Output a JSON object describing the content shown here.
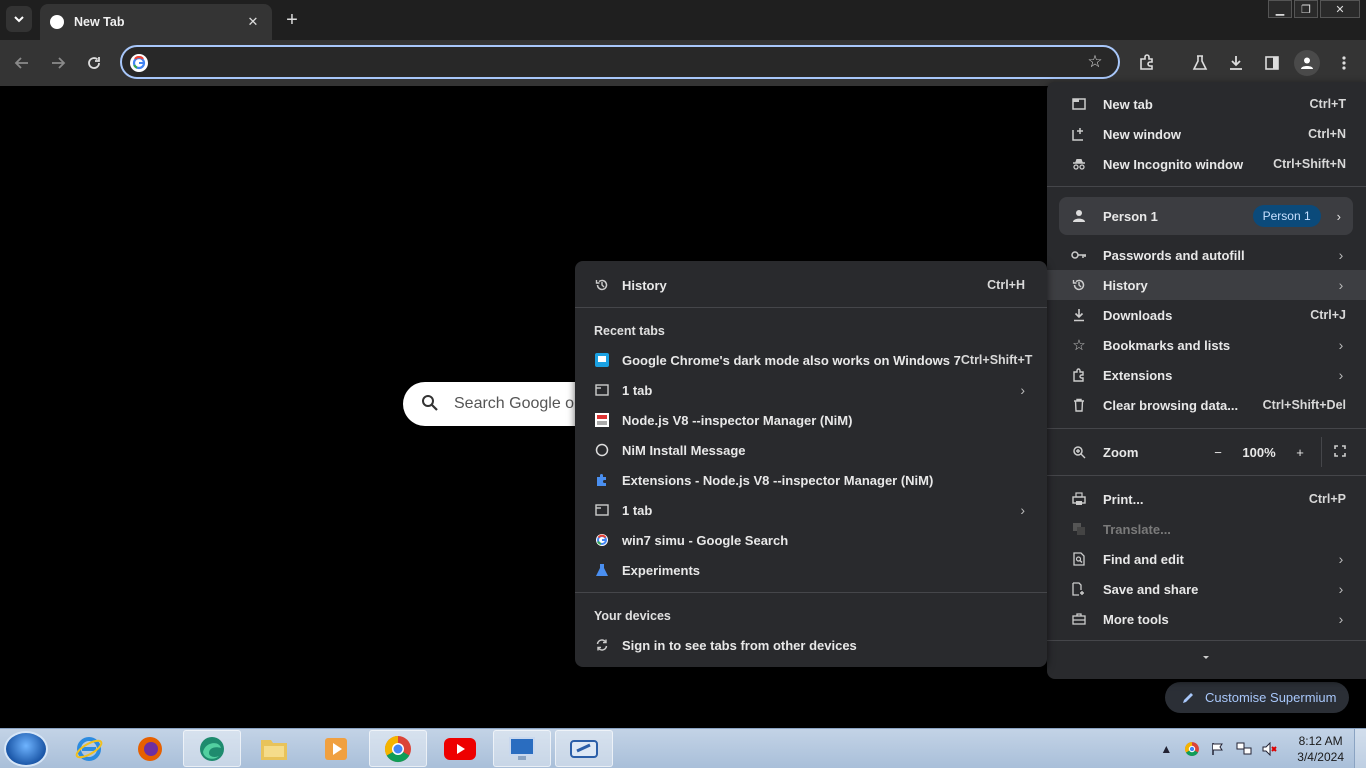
{
  "tab": {
    "title": "New Tab"
  },
  "ntp": {
    "search_placeholder": "Search Google or type a URL",
    "customise_label": "Customise Supermium"
  },
  "menu": {
    "items_top": [
      {
        "label": "New tab",
        "shortcut": "Ctrl+T",
        "icon": "new-tab-icon"
      },
      {
        "label": "New window",
        "shortcut": "Ctrl+N",
        "icon": "new-window-icon"
      },
      {
        "label": "New Incognito window",
        "shortcut": "Ctrl+Shift+N",
        "icon": "incognito-icon"
      }
    ],
    "person": {
      "label": "Person 1",
      "chip": "Person 1"
    },
    "items_mid": [
      {
        "label": "Passwords and autofill",
        "icon": "key-icon"
      },
      {
        "label": "History",
        "icon": "history-icon"
      },
      {
        "label": "Downloads",
        "shortcut": "Ctrl+J",
        "icon": "download-icon"
      },
      {
        "label": "Bookmarks and lists",
        "icon": "star-icon"
      },
      {
        "label": "Extensions",
        "icon": "puzzle-icon"
      },
      {
        "label": "Clear browsing data...",
        "shortcut": "Ctrl+Shift+Del",
        "icon": "trash-icon"
      }
    ],
    "zoom": {
      "label": "Zoom",
      "minus": "−",
      "value": "100%",
      "plus": "+"
    },
    "items_bottom": [
      {
        "label": "Print...",
        "shortcut": "Ctrl+P",
        "icon": "print-icon"
      },
      {
        "label": "Translate...",
        "icon": "translate-icon"
      },
      {
        "label": "Find and edit",
        "icon": "find-icon"
      },
      {
        "label": "Save and share",
        "icon": "save-icon"
      },
      {
        "label": "More tools",
        "icon": "toolbox-icon"
      }
    ]
  },
  "history": {
    "title": "History",
    "title_shortcut": "Ctrl+H",
    "recent_header": "Recent tabs",
    "recent": [
      {
        "label": "Google Chrome's dark mode also works on Windows 7",
        "shortcut": "Ctrl+Shift+T",
        "icon": "blog-favicon-icon"
      },
      {
        "label": "1 tab",
        "icon": "window-icon"
      },
      {
        "label": "Node.js V8 --inspector Manager (NiM)",
        "icon": "nim-favicon-icon"
      },
      {
        "label": "NiM Install Message",
        "icon": "globe-outline-icon"
      },
      {
        "label": "Extensions - Node.js V8 --inspector Manager (NiM)",
        "icon": "extension-favicon-icon"
      },
      {
        "label": "1 tab",
        "icon": "window-icon"
      },
      {
        "label": "win7 simu - Google Search",
        "icon": "google-favicon-icon"
      },
      {
        "label": "Experiments",
        "icon": "flask-icon"
      }
    ],
    "devices_header": "Your devices",
    "devices_item": "Sign in to see tabs from other devices"
  },
  "clock": {
    "time": "8:12 AM",
    "date": "3/4/2024"
  },
  "colors": {
    "accent": "#a8c7fa",
    "menu_bg": "#292a2d",
    "toolbar_bg": "#343434"
  }
}
